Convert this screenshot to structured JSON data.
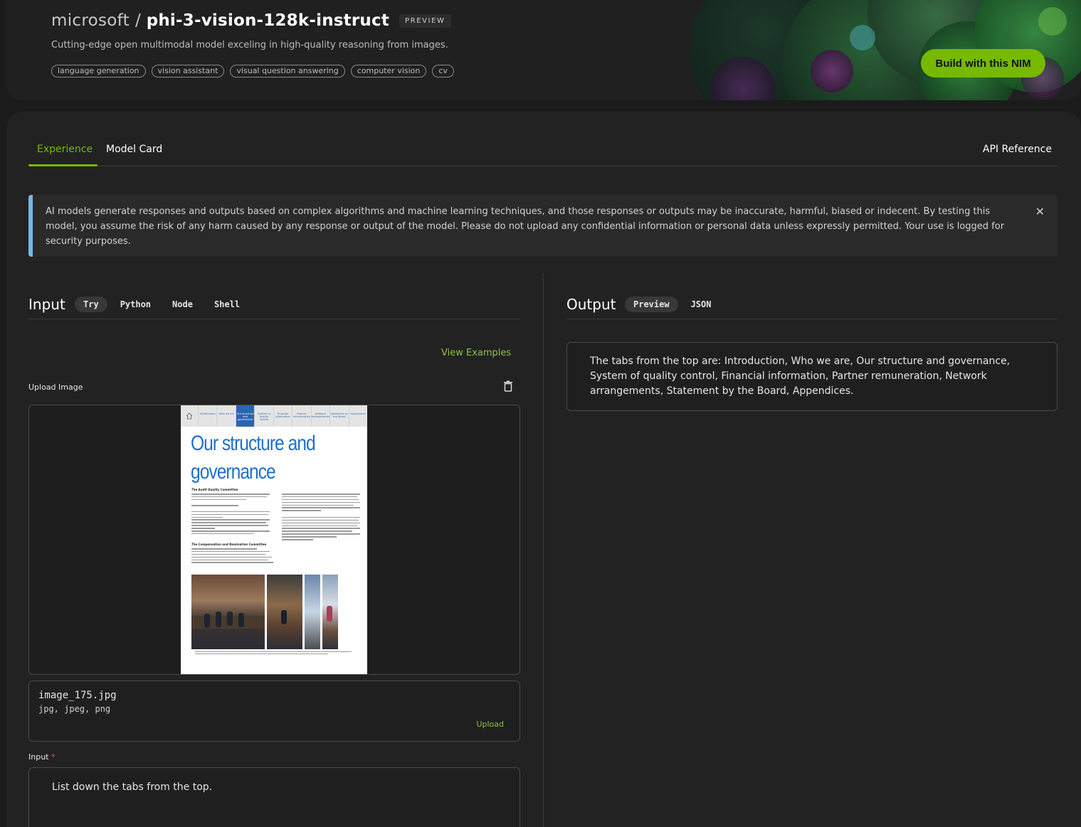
{
  "header": {
    "org": "microsoft",
    "separator": "/",
    "model": "phi-3-vision-128k-instruct",
    "badge": "PREVIEW",
    "subtitle": "Cutting-edge open multimodal model exceling in high-quality reasoning from images.",
    "tags": [
      "language generation",
      "vision assistant",
      "visual question answering",
      "computer vision",
      "cv"
    ],
    "build_button": "Build with this NIM",
    "brand_color": "#76b900"
  },
  "tabs": {
    "experience": "Experience",
    "model_card": "Model Card",
    "api_reference": "API Reference"
  },
  "banner": {
    "text": "AI models generate responses and outputs based on complex algorithms and machine learning techniques, and those responses or outputs may be inaccurate, harmful, biased or indecent. By testing this model, you assume the risk of any harm caused by any response or output of the model. Please do not upload any confidential information or personal data unless expressly permitted. Your use is logged for security purposes.",
    "close_icon": "close-icon"
  },
  "input_panel": {
    "title": "Input",
    "code_tabs": [
      "Try",
      "Python",
      "Node",
      "Shell"
    ],
    "active_tab": "Try",
    "view_examples": "View Examples",
    "upload_label": "Upload Image",
    "file_name": "image_175.jpg",
    "file_types": "jpg, jpeg, png",
    "upload_link": "Upload",
    "input_label": "Input",
    "required_mark": "*",
    "input_value": "List down the tabs from the top."
  },
  "uploaded_image": {
    "nav_items": [
      "Introduction",
      "Who we are",
      "Our structure and governance",
      "System of quality control",
      "Financial information",
      "Partner remuneration",
      "Network arrangements",
      "Statement by the Board",
      "Appendices"
    ],
    "active_nav": "Our structure and governance",
    "title_line1": "Our structure and",
    "title_line2": "governance",
    "heading1": "The Audit Quality Committee",
    "heading2": "The Compensation and Nomination Committee"
  },
  "output_panel": {
    "title": "Output",
    "tabs": [
      "Preview",
      "JSON"
    ],
    "active_tab": "Preview",
    "text": "The tabs from the top are: Introduction, Who we are, Our structure and governance, System of quality control, Financial information, Partner remuneration, Network arrangements, Statement by the Board, Appendices."
  }
}
